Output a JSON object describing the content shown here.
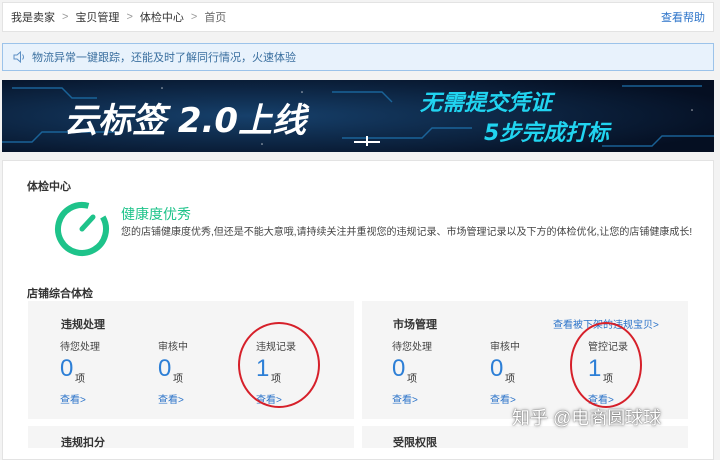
{
  "breadcrumb": {
    "items": [
      "我是卖家",
      "宝贝管理",
      "体检中心",
      "首页"
    ],
    "separator": ">",
    "help": "查看帮助"
  },
  "notice": {
    "text": "物流异常一键跟踪，还能及时了解同行情况，火速体验"
  },
  "banner": {
    "title": "云标签 2.0上线",
    "line1": "无需提交凭证",
    "line2": "5步完成打标"
  },
  "health": {
    "section_title": "体检中心",
    "heading": "健康度优秀",
    "description": "您的店铺健康度优秀,但还是不能大意哦,请持续关注并重视您的违规记录、市场管理记录以及下方的体检优化,让您的店铺健康成长!",
    "accent_color": "#1ec38a"
  },
  "overview": {
    "section_title": "店铺综合体检",
    "cards": [
      {
        "title": "违规处理",
        "stats": [
          {
            "label": "待您处理",
            "value": "0",
            "unit": "项",
            "link": "查看>"
          },
          {
            "label": "审核中",
            "value": "0",
            "unit": "项",
            "link": "查看>"
          },
          {
            "label": "违规记录",
            "value": "1",
            "unit": "项",
            "link": "查看>"
          }
        ]
      },
      {
        "title": "市场管理",
        "link": "查看被下架的违规宝贝>",
        "stats": [
          {
            "label": "待您处理",
            "value": "0",
            "unit": "项",
            "link": "查看>"
          },
          {
            "label": "审核中",
            "value": "0",
            "unit": "项",
            "link": "查看>"
          },
          {
            "label": "管控记录",
            "value": "1",
            "unit": "项",
            "link": "查看>"
          }
        ]
      },
      {
        "title": "违规扣分"
      },
      {
        "title": "受限权限"
      }
    ]
  },
  "watermark": {
    "text": "知乎 @电商圆球球"
  }
}
